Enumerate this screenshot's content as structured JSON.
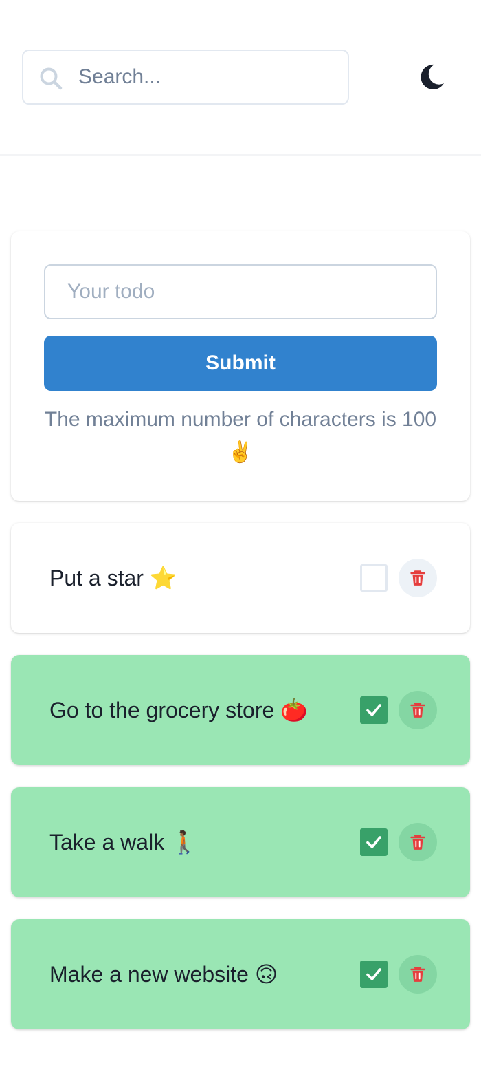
{
  "header": {
    "search_placeholder": "Search...",
    "theme_toggle_icon": "moon-icon"
  },
  "form": {
    "todo_placeholder": "Your todo",
    "submit_label": "Submit",
    "hint": "The maximum number of characters is 100 ✌️"
  },
  "todos": [
    {
      "text": "Put a star ⭐",
      "completed": false
    },
    {
      "text": "Go to the grocery store 🍅",
      "completed": true
    },
    {
      "text": "Take a walk 🚶🏾",
      "completed": true
    },
    {
      "text": "Make a new website 🙃",
      "completed": true
    }
  ],
  "colors": {
    "accent": "#3182ce",
    "completed_bg": "#9ae6b4",
    "checkbox_checked": "#38a169",
    "delete_icon": "#e53e3e"
  }
}
